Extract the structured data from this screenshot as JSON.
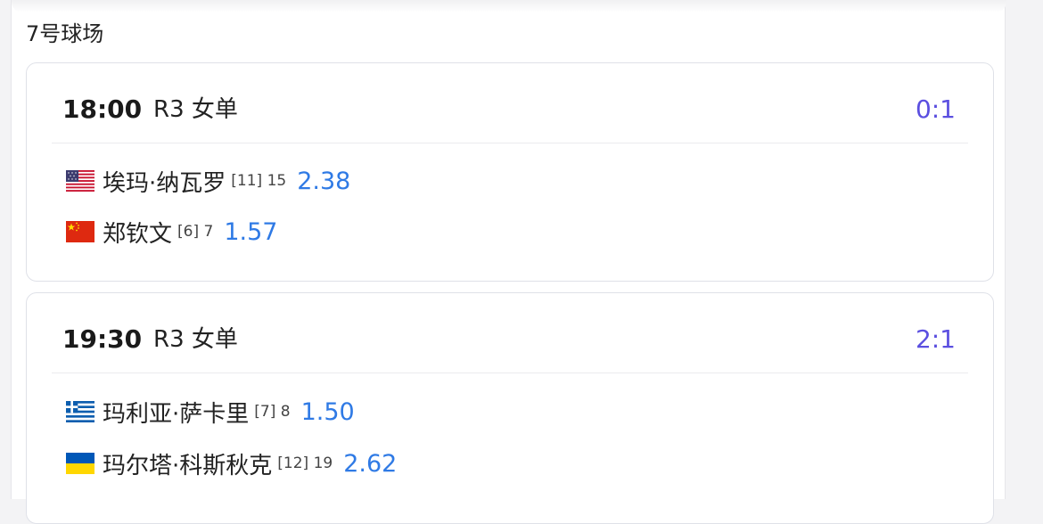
{
  "court": {
    "title": "7号球场"
  },
  "matches": [
    {
      "time": "18:00",
      "round": "R3 女单",
      "score": "0:1",
      "players": [
        {
          "flag": "usa-flag-icon",
          "name": "埃玛·纳瓦罗",
          "seed": "[11] 15",
          "odds": "2.38"
        },
        {
          "flag": "china-flag-icon",
          "name": "郑钦文",
          "seed": "[6] 7",
          "odds": "1.57"
        }
      ]
    },
    {
      "time": "19:30",
      "round": "R3 女单",
      "score": "2:1",
      "players": [
        {
          "flag": "greece-flag-icon",
          "name": "玛利亚·萨卡里",
          "seed": "[7] 8",
          "odds": "1.50"
        },
        {
          "flag": "ukraine-flag-icon",
          "name": "玛尔塔·科斯秋克",
          "seed": "[12] 19",
          "odds": "2.62"
        }
      ]
    }
  ]
}
